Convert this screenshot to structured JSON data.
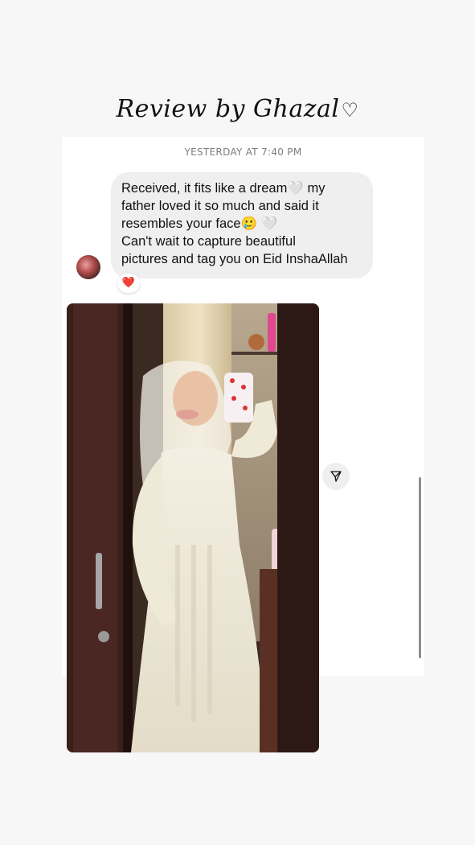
{
  "title": "Review by Ghazal",
  "title_heart": "♡",
  "chat": {
    "timestamp": "YESTERDAY AT 7:40 PM",
    "message_lines": [
      "Received, it fits like a dream🤍 my",
      "father loved it so much and said it",
      "resembles your face🥲 🤍",
      "Can't wait to capture beautiful",
      "pictures and tag you on Eid InshaAllah"
    ],
    "reaction": "❤️"
  },
  "icons": {
    "avatar": "avatar",
    "share": "paper-plane-icon"
  },
  "colors": {
    "background": "#f7f7f7",
    "panel": "#ffffff",
    "bubble": "#efefef",
    "timestamp": "#7d7d7d",
    "reaction": "#e0245e"
  }
}
